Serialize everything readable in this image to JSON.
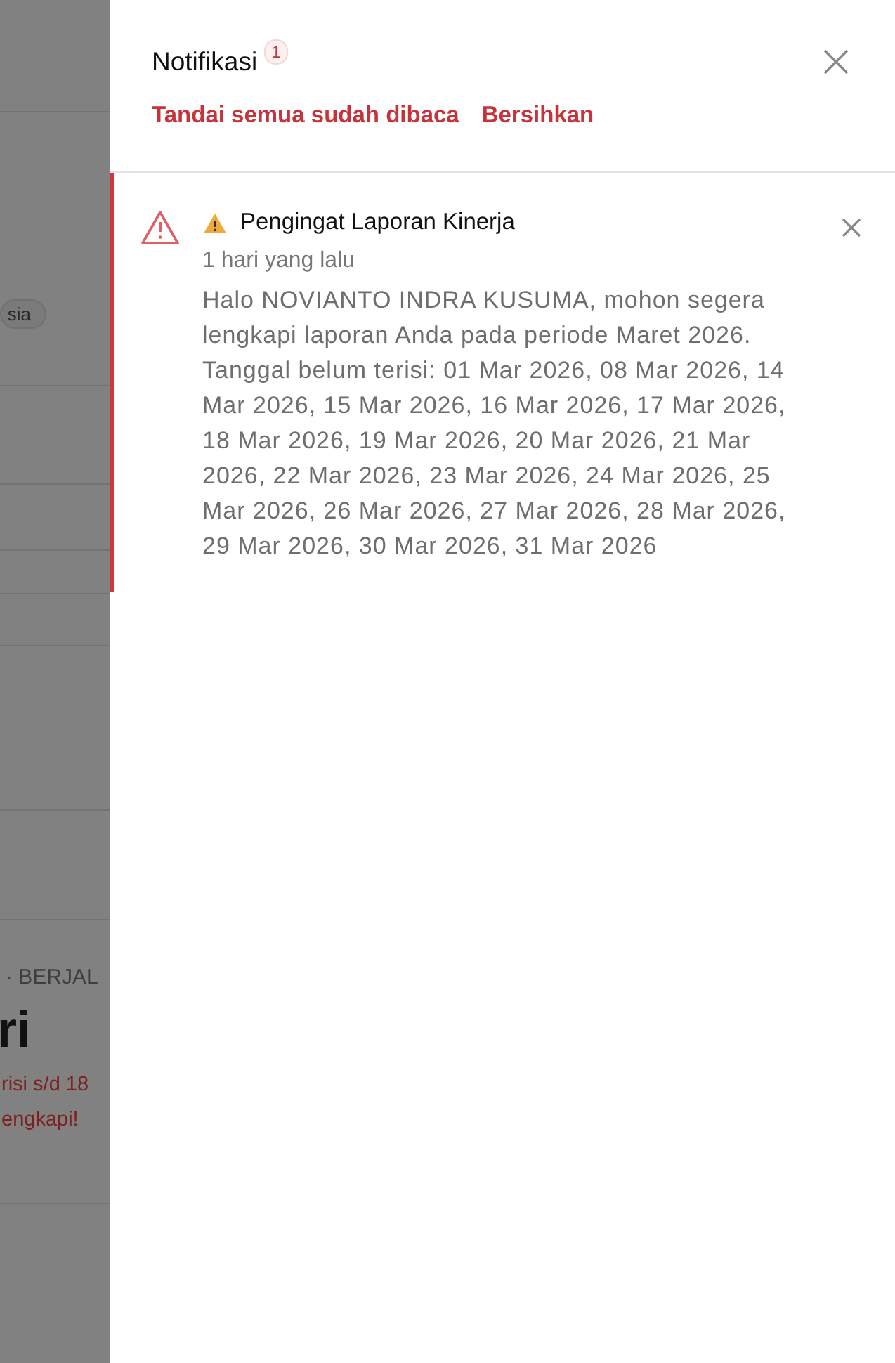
{
  "background_page": {
    "tag": "sia",
    "status": "· BERJAL",
    "heading": "ri",
    "note_lines": [
      "risi s/d 18",
      "engkapi!"
    ]
  },
  "panel": {
    "title": "Notifikasi",
    "unread_count": "1",
    "actions": [
      {
        "label": "Tandai semua sudah dibaca"
      },
      {
        "label": "Bersihkan"
      }
    ],
    "notifications": [
      {
        "kind": "warning",
        "unread": true,
        "title": "Pengingat Laporan Kinerja",
        "time": "1 hari yang lalu",
        "message": "Halo NOVIANTO INDRA KUSUMA, mohon segera lengkapi laporan Anda pada periode Maret 2026. Tanggal belum terisi: 01 Mar 2026, 08 Mar 2026, 14 Mar 2026, 15 Mar 2026, 16 Mar 2026, 17 Mar 2026, 18 Mar 2026, 19 Mar 2026, 20 Mar 2026, 21 Mar 2026, 22 Mar 2026, 23 Mar 2026, 24 Mar 2026, 25 Mar 2026, 26 Mar 2026, 27 Mar 2026, 28 Mar 2026, 29 Mar 2026, 30 Mar 2026, 31 Mar 2026"
      }
    ]
  }
}
